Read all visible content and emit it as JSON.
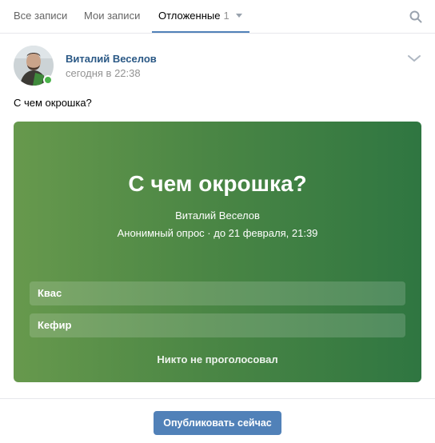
{
  "tabs": {
    "all": "Все записи",
    "mine": "Мои записи",
    "postponed": "Отложенные",
    "postponed_count": "1"
  },
  "post": {
    "author": "Виталий Веселов",
    "time": "сегодня в 22:38",
    "text": "С чем окрошка?"
  },
  "poll": {
    "title": "С чем окрошка?",
    "author": "Виталий Веселов",
    "meta": "Анонимный опрос · до 21 февраля, 21:39",
    "options": [
      "Квас",
      "Кефир"
    ],
    "votes": "Никто не проголосовал"
  },
  "publish_label": "Опубликовать сейчас",
  "colors": {
    "accent": "#5181b8",
    "link": "#2a5885",
    "online": "#4bb34b",
    "poll_gradient_start": "#67994d",
    "poll_gradient_end": "#2f7641"
  },
  "icons": {
    "search": "search-icon",
    "more": "chevron-down-icon",
    "dropdown": "caret-down-icon"
  }
}
